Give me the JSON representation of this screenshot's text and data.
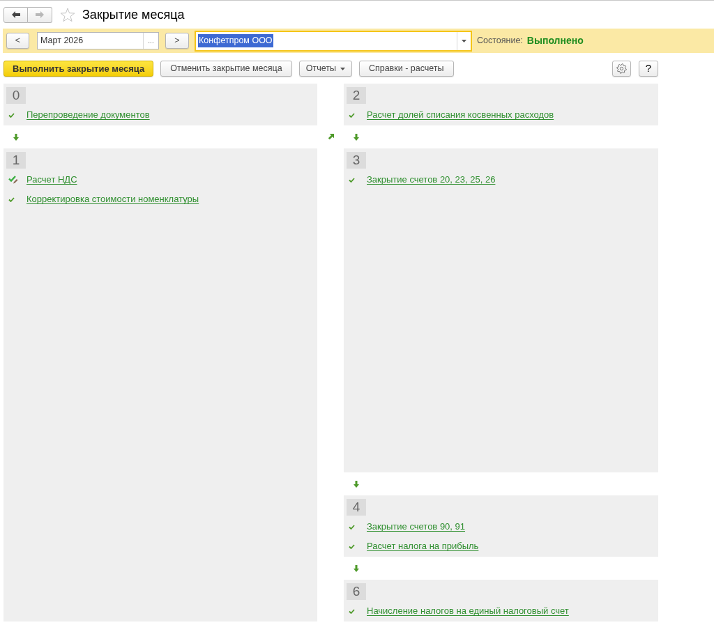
{
  "window": {
    "title": "Закрытие месяца",
    "favorite": false
  },
  "navigation": {
    "back": {
      "disabled": false
    },
    "forward": {
      "disabled": true
    }
  },
  "period_bar": {
    "prev_button": "<",
    "period": "Март 2026",
    "choose_button": "...",
    "next_button": ">",
    "organization": "Конфетпром ООО",
    "organization_selected": true,
    "status_label": "Состояние:",
    "status_value": "Выполнено"
  },
  "toolbar": {
    "buttons": [
      {
        "label": "Выполнить закрытие месяца",
        "kind": "primary"
      },
      {
        "label": "Отменить закрытие месяца",
        "kind": "plain"
      },
      {
        "label": "Отчеты",
        "kind": "menu"
      },
      {
        "label": "Справки - расчеты",
        "kind": "plain"
      }
    ],
    "help_button": "?"
  },
  "columns": [
    {
      "stages": [
        {
          "number": "0",
          "tasks": [
            {
              "label": "Перепроведение документов",
              "done": true,
              "edited": false
            }
          ]
        },
        {
          "number": "1",
          "tasks": [
            {
              "label": "Расчет НДС",
              "done": true,
              "edited": true
            },
            {
              "label": "Корректировка стоимости номенклатуры",
              "done": true,
              "edited": false
            }
          ]
        }
      ]
    },
    {
      "stages": [
        {
          "number": "2",
          "tasks": [
            {
              "label": "Расчет долей списания косвенных расходов",
              "done": true,
              "edited": false
            }
          ]
        },
        {
          "number": "3",
          "tasks": [
            {
              "label": "Закрытие счетов 20, 23, 25, 26",
              "done": true,
              "edited": false
            }
          ]
        },
        {
          "number": "4",
          "tasks": [
            {
              "label": "Закрытие счетов 90, 91",
              "done": true,
              "edited": false
            },
            {
              "label": "Расчет налога на прибыль",
              "done": true,
              "edited": false
            }
          ]
        },
        {
          "number": "6",
          "tasks": [
            {
              "label": "Начисление налогов на единый налоговый счет",
              "done": true,
              "edited": false
            }
          ]
        }
      ]
    }
  ]
}
